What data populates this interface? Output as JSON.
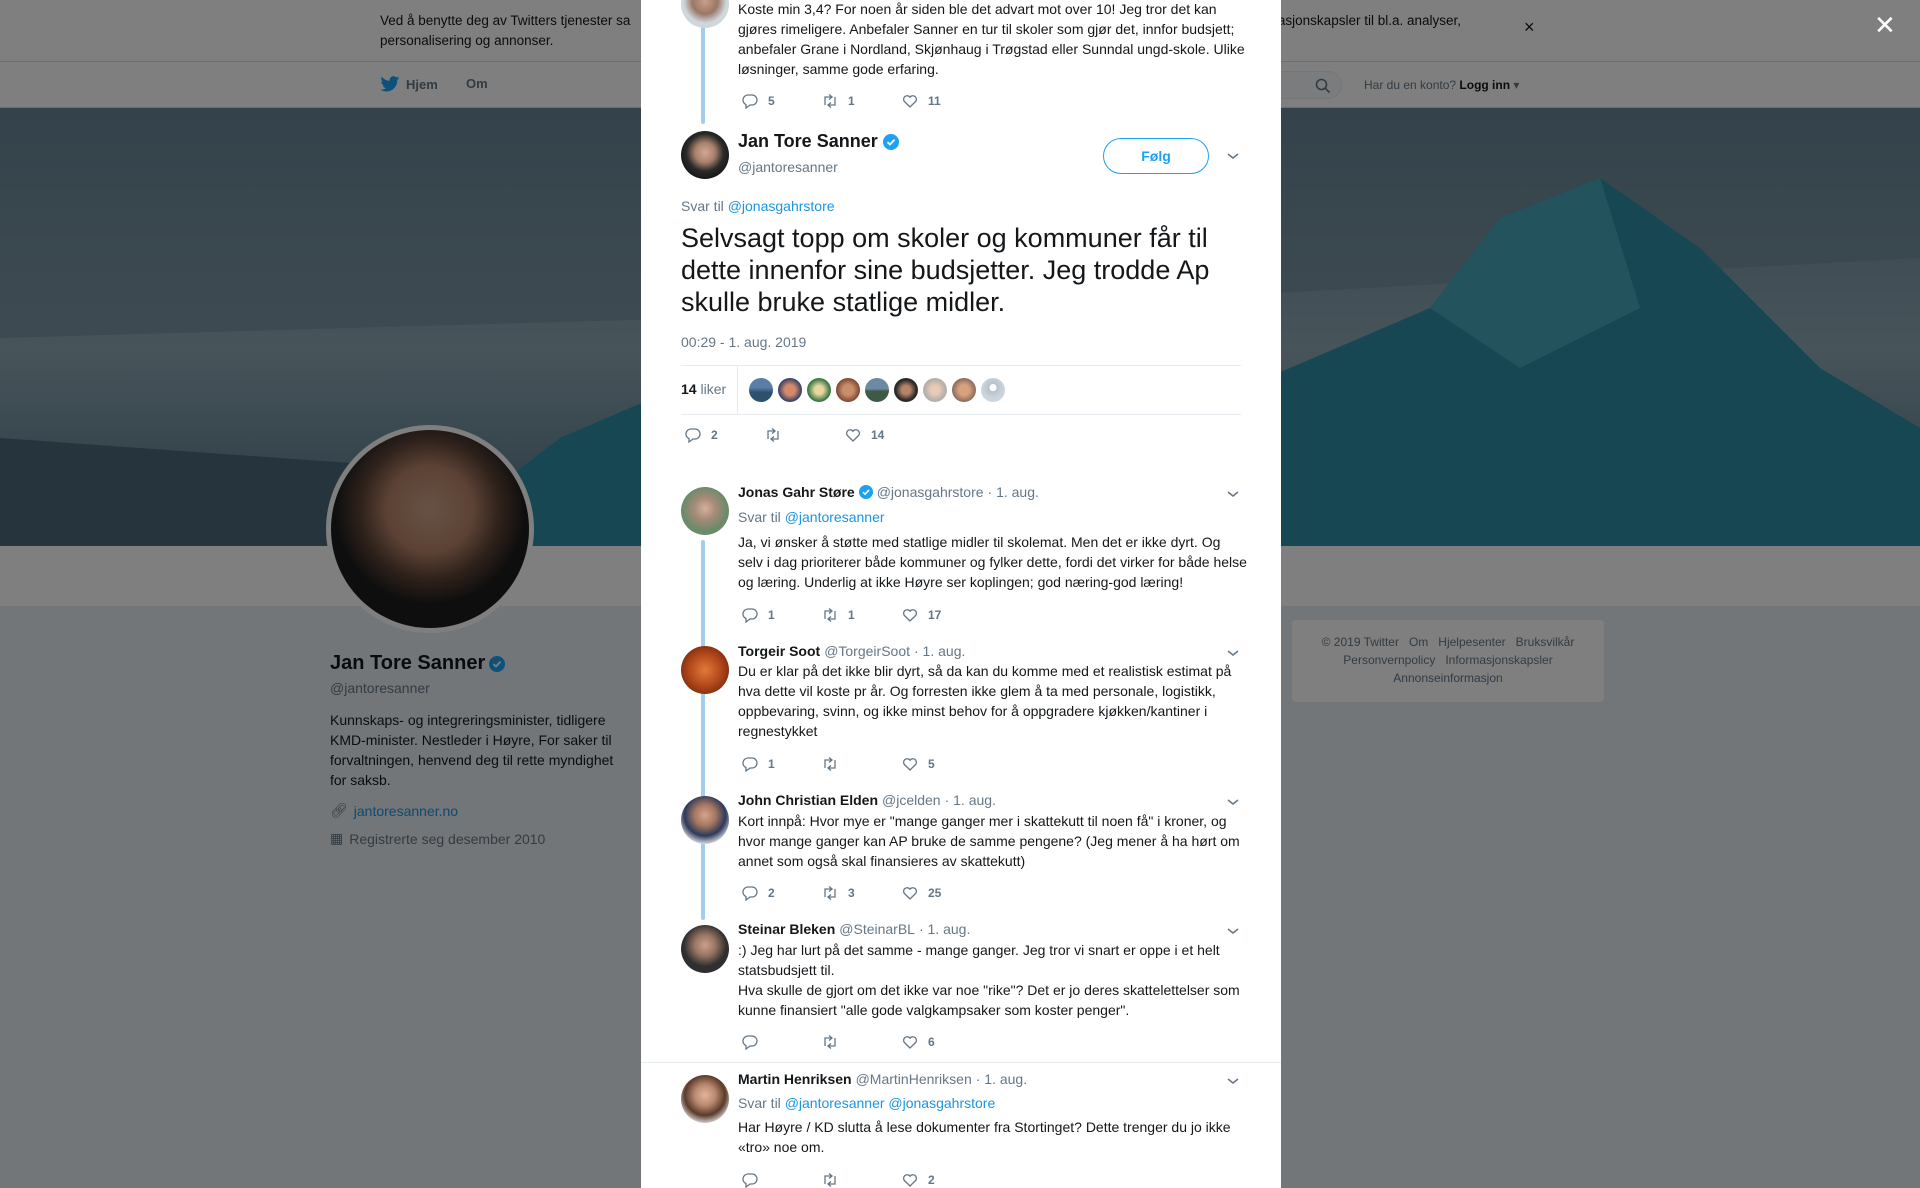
{
  "background": {
    "cookie_text": "Ved å benytte deg av Twitters tjenester sa… informasjonskapsler til bl.a. analyser, personalisering og annonser.",
    "cookie_text_visible_left": "Ved å benytte deg av Twitters tjenester sa",
    "cookie_text_visible_right": "informasjonskapsler til bl.a. analyser,",
    "cookie_text_line2": "personalisering og annonser.",
    "cookie_close": "×",
    "nav": {
      "home": "Hjem",
      "about": "Om",
      "account_prompt": "Har du en konto?",
      "login": "Logg inn"
    },
    "profile": {
      "name": "Jan Tore Sanner",
      "handle": "@jantoresanner",
      "bio": "Kunnskaps- og integreringsminister, tidligere KMD-minister. Nestleder i Høyre, For saker til forvaltningen, henvend deg til rette myndighet for saksb.",
      "link": "jantoresanner.no",
      "joined": "Registrerte seg desember 2010"
    },
    "footer": {
      "row1": [
        "© 2019 Twitter",
        "Om",
        "Hjelpesenter",
        "Bruksvilkår"
      ],
      "row2": [
        "Personvernpolicy",
        "Informasjonskapsler"
      ],
      "row3": [
        "Annonseinformasjon"
      ]
    }
  },
  "overlay_close": "✕",
  "parent_tweet": {
    "text": "Koste min 3,4? For noen år siden ble det advart mot over 10! Jeg tror det kan gjøres rimeligere. Anbefaler Sanner en tur til skoler som gjør det, innfor budsjett; anbefaler Grane i Nordland, Skjønhaug i Trøgstad eller Sunndal ungd-skole. Ulike løsninger, samme gode erfaring.",
    "replies": "5",
    "retweets": "1",
    "likes": "11"
  },
  "main_tweet": {
    "name": "Jan Tore Sanner",
    "handle": "@jantoresanner",
    "follow": "Følg",
    "reply_to_label": "Svar til",
    "reply_to": "@jonasgahrstore",
    "text": "Selvsagt topp om skoler og kommuner får til dette innenfor sine budsjetter. Jeg trodde Ap skulle bruke statlige midler.",
    "timestamp": "00:29 - 1. aug. 2019",
    "likes_count": "14",
    "likes_label": "liker",
    "replies": "2",
    "retweets": "",
    "likes": "14"
  },
  "replies": [
    {
      "name": "Jonas Gahr Støre",
      "verified": true,
      "handle": "@jonasgahrstore",
      "date": "· 1. aug.",
      "reply_to_label": "Svar til",
      "reply_to": "@jantoresanner",
      "text": "Ja, vi ønsker å støtte med statlige midler til skolemat. Men det er ikke dyrt. Og selv i dag prioriterer både kommuner og fylker dette, fordi det virker for både helse og læring. Underlig at ikke Høyre ser koplingen; god næring-god læring!",
      "replies": "1",
      "retweets": "1",
      "likes": "17"
    },
    {
      "name": "Torgeir Soot",
      "verified": false,
      "handle": "@TorgeirSoot",
      "date": "· 1. aug.",
      "text": "Du er klar på det ikke blir dyrt, så da kan du komme med et realistisk estimat på hva dette vil koste pr år. Og forresten ikke glem å ta med personale, logistikk, oppbevaring, svinn, og ikke minst behov for å oppgradere kjøkken/kantiner i regnestykket",
      "replies": "1",
      "retweets": "",
      "likes": "5"
    },
    {
      "name": "John Christian Elden",
      "verified": false,
      "handle": "@jcelden",
      "date": "· 1. aug.",
      "text": "Kort innpå: Hvor mye er \"mange ganger mer i skattekutt til noen få\" i kroner, og hvor mange ganger kan AP bruke de samme pengene? (Jeg mener å ha hørt om annet som også skal finansieres av skattekutt)",
      "replies": "2",
      "retweets": "3",
      "likes": "25"
    },
    {
      "name": "Steinar Bleken",
      "verified": false,
      "handle": "@SteinarBL",
      "date": "· 1. aug.",
      "text1": ":) Jeg har lurt på det samme - mange ganger. Jeg tror vi snart er oppe i et helt statsbudsjett til.",
      "text2": "Hva skulle de gjort om det ikke var noe \"rike\"? Det er jo deres skattelettelser som kunne finansiert \"alle gode valgkampsaker som koster penger\".",
      "replies": "",
      "retweets": "",
      "likes": "6"
    },
    {
      "name": "Martin Henriksen",
      "verified": false,
      "handle": "@MartinHenriksen",
      "date": "· 1. aug.",
      "reply_to_label": "Svar til",
      "reply_to": "@jantoresanner @jonasgahrstore",
      "text": "Har Høyre / KD slutta å lese dokumenter fra Stortinget? Dette trenger du jo ikke «tro» noe om.",
      "replies": "",
      "retweets": "",
      "likes": "2"
    }
  ],
  "colors": {
    "accent": "#1da1f2",
    "link": "#1b95e0",
    "muted": "#657786",
    "thread_line": "#a2cdee"
  }
}
